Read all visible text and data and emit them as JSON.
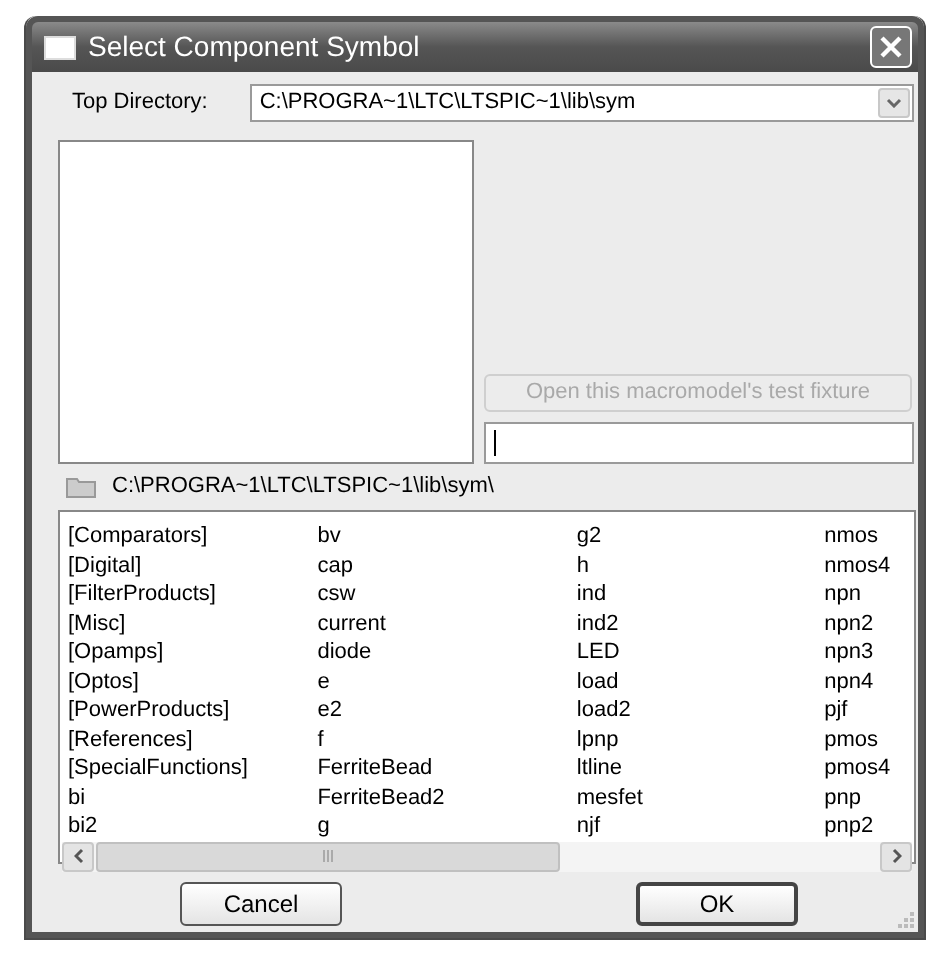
{
  "window": {
    "title": "Select Component Symbol"
  },
  "top_directory": {
    "label": "Top Directory:",
    "value": "C:\\PROGRA~1\\LTC\\LTSPIC~1\\lib\\sym"
  },
  "test_fixture_button": {
    "label": "Open this macromodel's test fixture",
    "disabled": true
  },
  "current_path": "C:\\PROGRA~1\\LTC\\LTSPIC~1\\lib\\sym\\",
  "symbol_list": {
    "columns": [
      [
        "[Comparators]",
        "[Digital]",
        "[FilterProducts]",
        "[Misc]",
        "[Opamps]",
        "[Optos]",
        "[PowerProducts]",
        "[References]",
        "[SpecialFunctions]",
        "bi",
        "bi2"
      ],
      [
        "bv",
        "cap",
        "csw",
        "current",
        "diode",
        "e",
        "e2",
        "f",
        "FerriteBead",
        "FerriteBead2",
        "g"
      ],
      [
        "g2",
        "h",
        "ind",
        "ind2",
        "LED",
        "load",
        "load2",
        "lpnp",
        "ltline",
        "mesfet",
        "njf"
      ],
      [
        "nmos",
        "nmos4",
        "npn",
        "npn2",
        "npn3",
        "npn4",
        "pjf",
        "pmos",
        "pmos4",
        "pnp",
        "pnp2"
      ]
    ]
  },
  "buttons": [
    {
      "label": "Cancel",
      "default": false
    },
    {
      "label": "OK",
      "default": true
    }
  ]
}
